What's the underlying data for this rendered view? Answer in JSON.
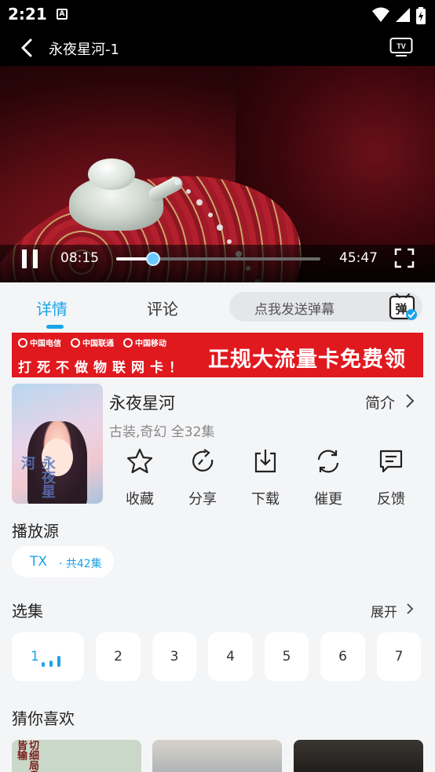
{
  "status_bar": {
    "time": "2:21",
    "notification_icon": "A"
  },
  "header": {
    "title": "永夜星河-1",
    "back_icon": "chevron-left-icon",
    "cast_icon": "tv-icon",
    "cast_label": "TV"
  },
  "player": {
    "current_time": "08:15",
    "total_time": "45:47",
    "progress": 0.18,
    "state": "playing",
    "accent": "#6ec6ff"
  },
  "tabs": [
    {
      "label": "详情",
      "active": true
    },
    {
      "label": "评论",
      "active": false
    }
  ],
  "danmaku": {
    "placeholder": "点我发送弹幕",
    "icon_label": "弹"
  },
  "ad_banner": {
    "carriers": [
      "中国电信",
      "中国联通",
      "中国移动"
    ],
    "slogan": "打死不做物联网卡！",
    "headline": "正规大流量卡免费领"
  },
  "show": {
    "title": "永夜星河",
    "meta": "古装,奇幻 全32集",
    "intro_label": "简介",
    "poster_text": "永夜星河"
  },
  "actions": [
    {
      "label": "收藏",
      "icon": "star-icon"
    },
    {
      "label": "分享",
      "icon": "share-icon"
    },
    {
      "label": "下载",
      "icon": "download-icon"
    },
    {
      "label": "催更",
      "icon": "refresh-icon"
    },
    {
      "label": "反馈",
      "icon": "feedback-icon"
    }
  ],
  "source": {
    "section_title": "播放源",
    "name": "TX",
    "count": "· 共42集"
  },
  "episodes": {
    "section_title": "选集",
    "expand_label": "展开",
    "items": [
      "1",
      "2",
      "3",
      "4",
      "5",
      "6",
      "7"
    ],
    "selected": "1"
  },
  "recommend": {
    "section_title": "猜你喜欢"
  },
  "colors": {
    "accent": "#1aa3e8",
    "banner_red": "#e0191f",
    "background": "#f4f5f7"
  }
}
